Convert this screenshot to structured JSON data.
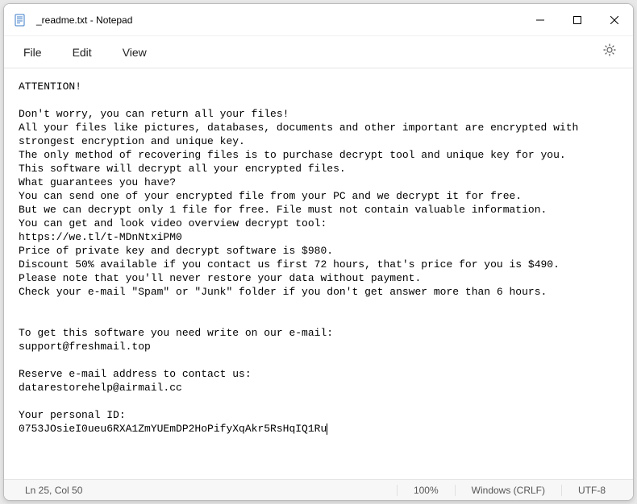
{
  "title": "_readme.txt - Notepad",
  "menu": {
    "file": "File",
    "edit": "Edit",
    "view": "View"
  },
  "body": {
    "l0": "ATTENTION!",
    "l1": "",
    "l2": "Don't worry, you can return all your files!",
    "l3": "All your files like pictures, databases, documents and other important are encrypted with strongest encryption and unique key.",
    "l4": "The only method of recovering files is to purchase decrypt tool and unique key for you.",
    "l5": "This software will decrypt all your encrypted files.",
    "l6": "What guarantees you have?",
    "l7": "You can send one of your encrypted file from your PC and we decrypt it for free.",
    "l8": "But we can decrypt only 1 file for free. File must not contain valuable information.",
    "l9": "You can get and look video overview decrypt tool:",
    "l10": "https://we.tl/t-MDnNtxiPM0",
    "l11": "Price of private key and decrypt software is $980.",
    "l12": "Discount 50% available if you contact us first 72 hours, that's price for you is $490.",
    "l13": "Please note that you'll never restore your data without payment.",
    "l14": "Check your e-mail \"Spam\" or \"Junk\" folder if you don't get answer more than 6 hours.",
    "l15": "",
    "l16": "",
    "l17": "To get this software you need write on our e-mail:",
    "l18": "support@freshmail.top",
    "l19": "",
    "l20": "Reserve e-mail address to contact us:",
    "l21": "datarestorehelp@airmail.cc",
    "l22": "",
    "l23": "Your personal ID:",
    "l24": "0753JOsieI0ueu6RXA1ZmYUEmDP2HoPifyXqAkr5RsHqIQ1Ru"
  },
  "status": {
    "position": "Ln 25, Col 50",
    "zoom": "100%",
    "lineend": "Windows (CRLF)",
    "encoding": "UTF-8"
  }
}
